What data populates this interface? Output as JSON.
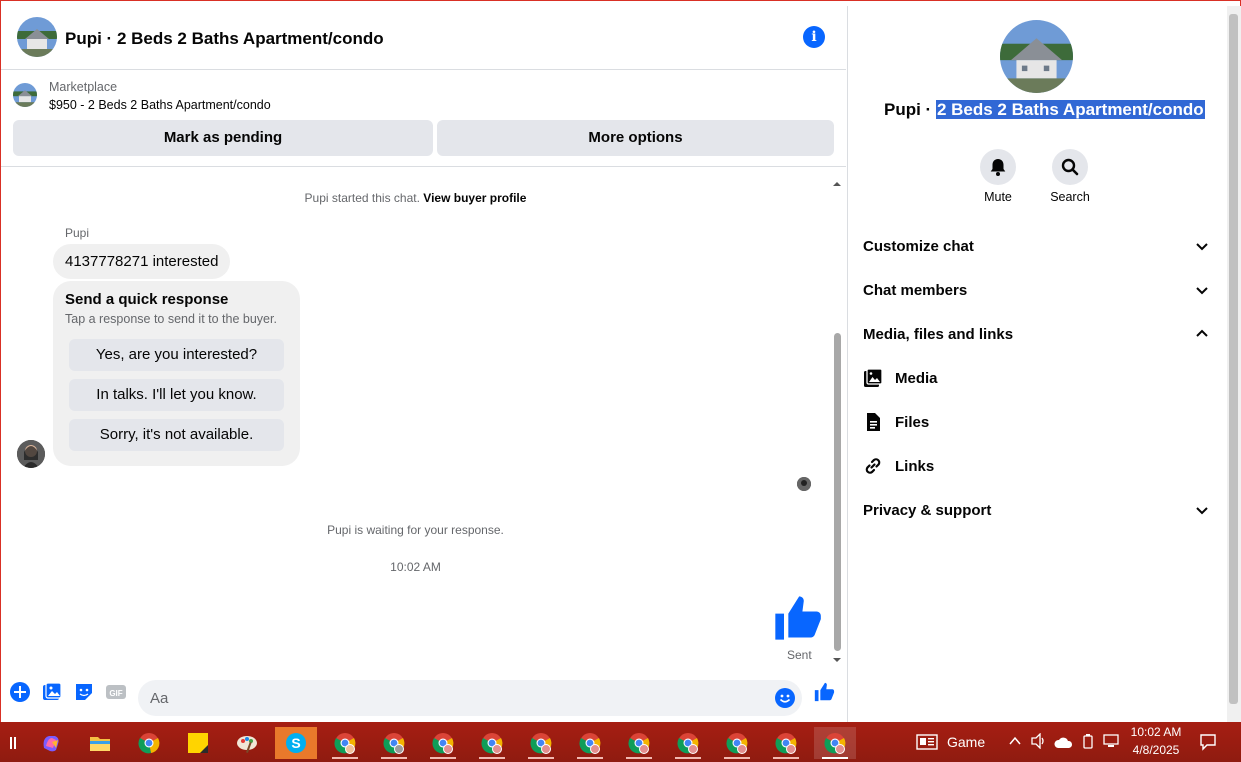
{
  "chat_header": {
    "title": "Pupi · 2 Beds 2 Baths Apartment/condo"
  },
  "marketplace": {
    "label": "Marketplace",
    "listing": "$950 - 2 Beds 2 Baths Apartment/condo",
    "mark_pending": "Mark as pending",
    "more_options": "More options"
  },
  "messages": {
    "started_text": "Pupi started this chat.",
    "view_profile": "View buyer profile",
    "sender": "Pupi",
    "first_message": "4137778271 interested",
    "quick_response_title": "Send a quick response",
    "quick_response_sub": "Tap a response to send it to the buyer.",
    "quick_responses": [
      "Yes, are you interested?",
      "In talks. I'll let you know.",
      "Sorry, it's not available."
    ],
    "waiting": "Pupi is waiting for your response.",
    "timestamp": "10:02 AM",
    "sent_label": "Sent"
  },
  "composer": {
    "placeholder": "Aa"
  },
  "right_panel": {
    "name_prefix": "Pupi · ",
    "name_highlight": "2 Beds 2 Baths Apartment/condo",
    "mute": "Mute",
    "search": "Search",
    "sections": {
      "customize": "Customize chat",
      "members": "Chat members",
      "media_files_links": "Media, files and links",
      "privacy": "Privacy & support"
    },
    "sub_items": {
      "media": "Media",
      "files": "Files",
      "links": "Links"
    }
  },
  "taskbar": {
    "widget": "Game",
    "time": "10:02 AM",
    "date": "4/8/2025"
  },
  "colors": {
    "accent": "#0866ff",
    "highlight": "#3168d5",
    "taskbar": "#a61e12",
    "bubble": "#f0f0f0"
  }
}
